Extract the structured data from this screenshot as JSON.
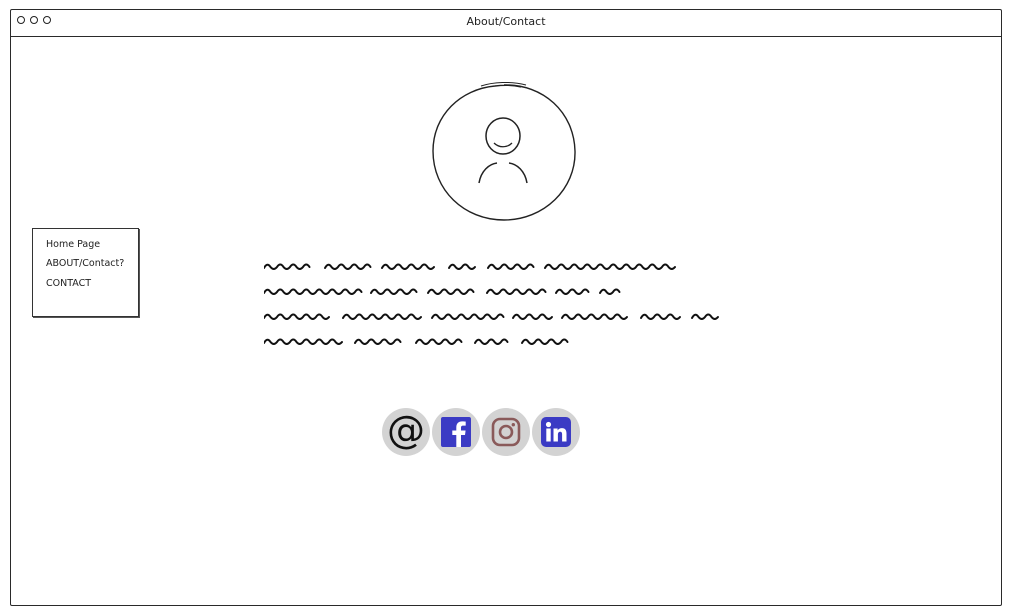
{
  "window": {
    "title": "About/Contact"
  },
  "nav": {
    "items": [
      {
        "label": "Home Page"
      },
      {
        "label": "ABOUT/Contact?"
      },
      {
        "label": "CONTACT"
      }
    ]
  },
  "profile": {
    "avatar_icon": "user-avatar-icon"
  },
  "bio": {
    "placeholder_lines": 4
  },
  "socials": [
    {
      "icon": "email-at-icon",
      "color": "#111111"
    },
    {
      "icon": "facebook-icon",
      "color": "#3b3bc4"
    },
    {
      "icon": "instagram-icon",
      "color": "#8a5a5a"
    },
    {
      "icon": "linkedin-icon",
      "color": "#3b3bc4"
    }
  ],
  "colors": {
    "icon_bg": "#d3d3d3",
    "outline": "#2a2a2a"
  }
}
